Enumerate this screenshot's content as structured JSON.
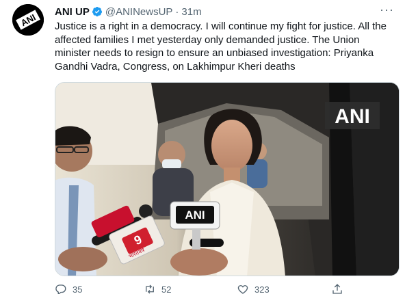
{
  "tweet": {
    "author_name": "ANI UP",
    "handle": "@ANINewsUP",
    "separator": "·",
    "time": "31m",
    "more_label": "···",
    "text": "Justice is a right in a democracy. I will continue my fight for justice. All the affected families I met yesterday only demanded justice. The Union minister needs to resign to ensure an unbiased investigation: Priyanka Gandhi Vadra, Congress, on Lakhimpur Kheri deaths",
    "avatar_logo": "ANI",
    "media": {
      "watermark": "ANI",
      "mic_ani_label": "ANI",
      "mic_tv9_label": "9",
      "mic_tv9_sub": "भारतवर्ष"
    },
    "actions": {
      "reply_count": "35",
      "retweet_count": "52",
      "like_count": "323"
    }
  },
  "colors": {
    "text": "#0f1419",
    "secondary": "#536471",
    "verified": "#1d9bf0",
    "border": "#cfd9de"
  }
}
